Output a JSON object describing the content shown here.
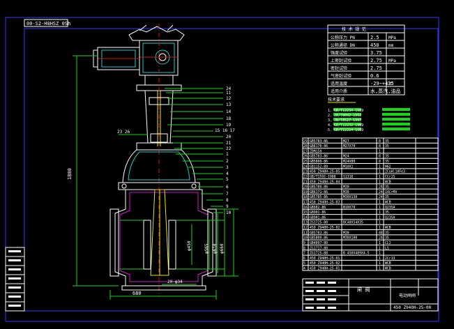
{
  "colors": {
    "background": "#000000",
    "frame": "#2c3cff",
    "outline": "#ffffff",
    "leader": "#16d716",
    "highlight": "#e6e61a"
  },
  "stamp": "00-S2-H0HSZ 0Sh",
  "spec_table": {
    "rows": [
      {
        "label": "公称压力 PN",
        "value": "2.5",
        "unit": "MPa"
      },
      {
        "label": "公称通径 DN",
        "value": "450",
        "unit": "mm"
      },
      {
        "label": "强度试验",
        "value": "3.75",
        "unit": ""
      },
      {
        "label": "上密封试验",
        "value": "2.75",
        "unit": "MPa"
      },
      {
        "label": "密封试验",
        "value": "2.75",
        "unit": ""
      },
      {
        "label": "气密封试验",
        "value": "0.6",
        "unit": ""
      },
      {
        "label": "适用温度",
        "value": "-29~+425",
        "unit": "℃"
      },
      {
        "label": "适用介质",
        "value": "水,蒸汽,油品",
        "unit": ""
      }
    ]
  },
  "tech_req": {
    "title": "技术要求",
    "lines": [
      "1.           GB/T12234-1989",
      "2.           JB/T8092-1992",
      "3.           JB/T8527-1997",
      "4.           GB/T12232-1989",
      "5.           GB/T12224-1989"
    ]
  },
  "dims": {
    "height": "1880",
    "width": "680",
    "bore": "φ450",
    "d2": "φ565",
    "d3": "φ610",
    "d4": "φ660",
    "bolts": "20-φ34",
    "side_a": "23 26",
    "side_b": "15 16 17"
  },
  "balloons": [
    "24",
    "11",
    "12",
    "13",
    "14",
    "18",
    "19",
    "20",
    "21",
    "22",
    "1",
    "2",
    "3",
    "4",
    "5",
    "6",
    "7",
    "8",
    "9",
    "10"
  ],
  "bom_rows": [
    {
      "no": "29",
      "code": "GB5783-86",
      "name": "M27",
      "qty": "8",
      "mat": "35"
    },
    {
      "no": "28",
      "code": "GB6170-86",
      "name": "M27X70",
      "qty": "8",
      "mat": "35"
    },
    {
      "no": "27",
      "code": "ZDM150",
      "name": "",
      "qty": "1",
      "mat": ""
    },
    {
      "no": "26",
      "code": "GB5783-86",
      "name": "M24",
      "qty": "8",
      "mat": "35"
    },
    {
      "no": "25",
      "code": "GB5800-86",
      "name": "M24X80",
      "qty": "8",
      "mat": "35"
    },
    {
      "no": "24",
      "code": "GB1152-89",
      "name": "M10X1",
      "qty": "1",
      "mat": "H62"
    },
    {
      "no": "23",
      "code": "450 Z940H-25-05",
      "name": "",
      "qty": "1",
      "mat": "ZCuAl10Fe3"
    },
    {
      "no": "22",
      "code": "GB/T1591-1988",
      "name": "S1316",
      "qty": "1",
      "mat": "CCr15"
    },
    {
      "no": "21",
      "code": "450 Z940H-25-04",
      "name": "",
      "qty": "1",
      "mat": "WCB"
    },
    {
      "no": "20",
      "code": "GB5780-86",
      "name": "M30",
      "qty": "24",
      "mat": "35"
    },
    {
      "no": "19",
      "code": "GB6171-86",
      "name": "M30",
      "qty": "24",
      "mat": "14CrMV"
    },
    {
      "no": "18",
      "code": "GB5785-86",
      "name": "M30X130",
      "qty": "24",
      "mat": "35"
    },
    {
      "no": "17",
      "code": "450 Z940H-25-03",
      "name": "",
      "qty": "1",
      "mat": "WCB"
    },
    {
      "no": "16",
      "code": "GB902-86",
      "name": "B10X70",
      "qty": "1",
      "mat": "Q235A"
    },
    {
      "no": "15",
      "code": "GB901-86",
      "name": "",
      "qty": "1",
      "mat": "35"
    },
    {
      "no": "14",
      "code": "GB901-86",
      "name": "",
      "qty": "1",
      "mat": "Q235A"
    },
    {
      "no": "13",
      "code": "ZG1725-88",
      "name": "BC40X54X35",
      "qty": "1",
      "mat": ""
    },
    {
      "no": "12",
      "code": "450 Z940H-25-02",
      "name": "",
      "qty": "1",
      "mat": "WCB"
    },
    {
      "no": "11",
      "code": "GB5783-86",
      "name": "M30",
      "qty": "48",
      "mat": "35"
    },
    {
      "no": "10",
      "code": "GB5800-86",
      "name": "M30X100",
      "qty": "24",
      "mat": "35"
    },
    {
      "no": "9",
      "code": "GB4097-80",
      "name": "",
      "qty": "1",
      "mat": "CL2"
    },
    {
      "no": "8",
      "code": "ZG1717-80",
      "name": "",
      "qty": "1",
      "mat": "LS"
    },
    {
      "no": "7",
      "code": "ZG1725-88",
      "name": "B 450X489X4.5",
      "qty": "1",
      "mat": ""
    },
    {
      "no": "6",
      "code": "450 Z940H-25-01",
      "name": "",
      "qty": "1",
      "mat": "2Cr13"
    },
    {
      "no": "5",
      "code": "450 Z940H-25-02",
      "name": "",
      "qty": "1",
      "mat": "WCB"
    },
    {
      "no": "4",
      "code": "450 Z940H-25-01",
      "name": "",
      "qty": "1",
      "mat": "WCB"
    }
  ],
  "title_block": {
    "name_left": "闸 阀",
    "name_right": "电动闸阀",
    "drawing_no": "450 Z940H-25-00"
  }
}
